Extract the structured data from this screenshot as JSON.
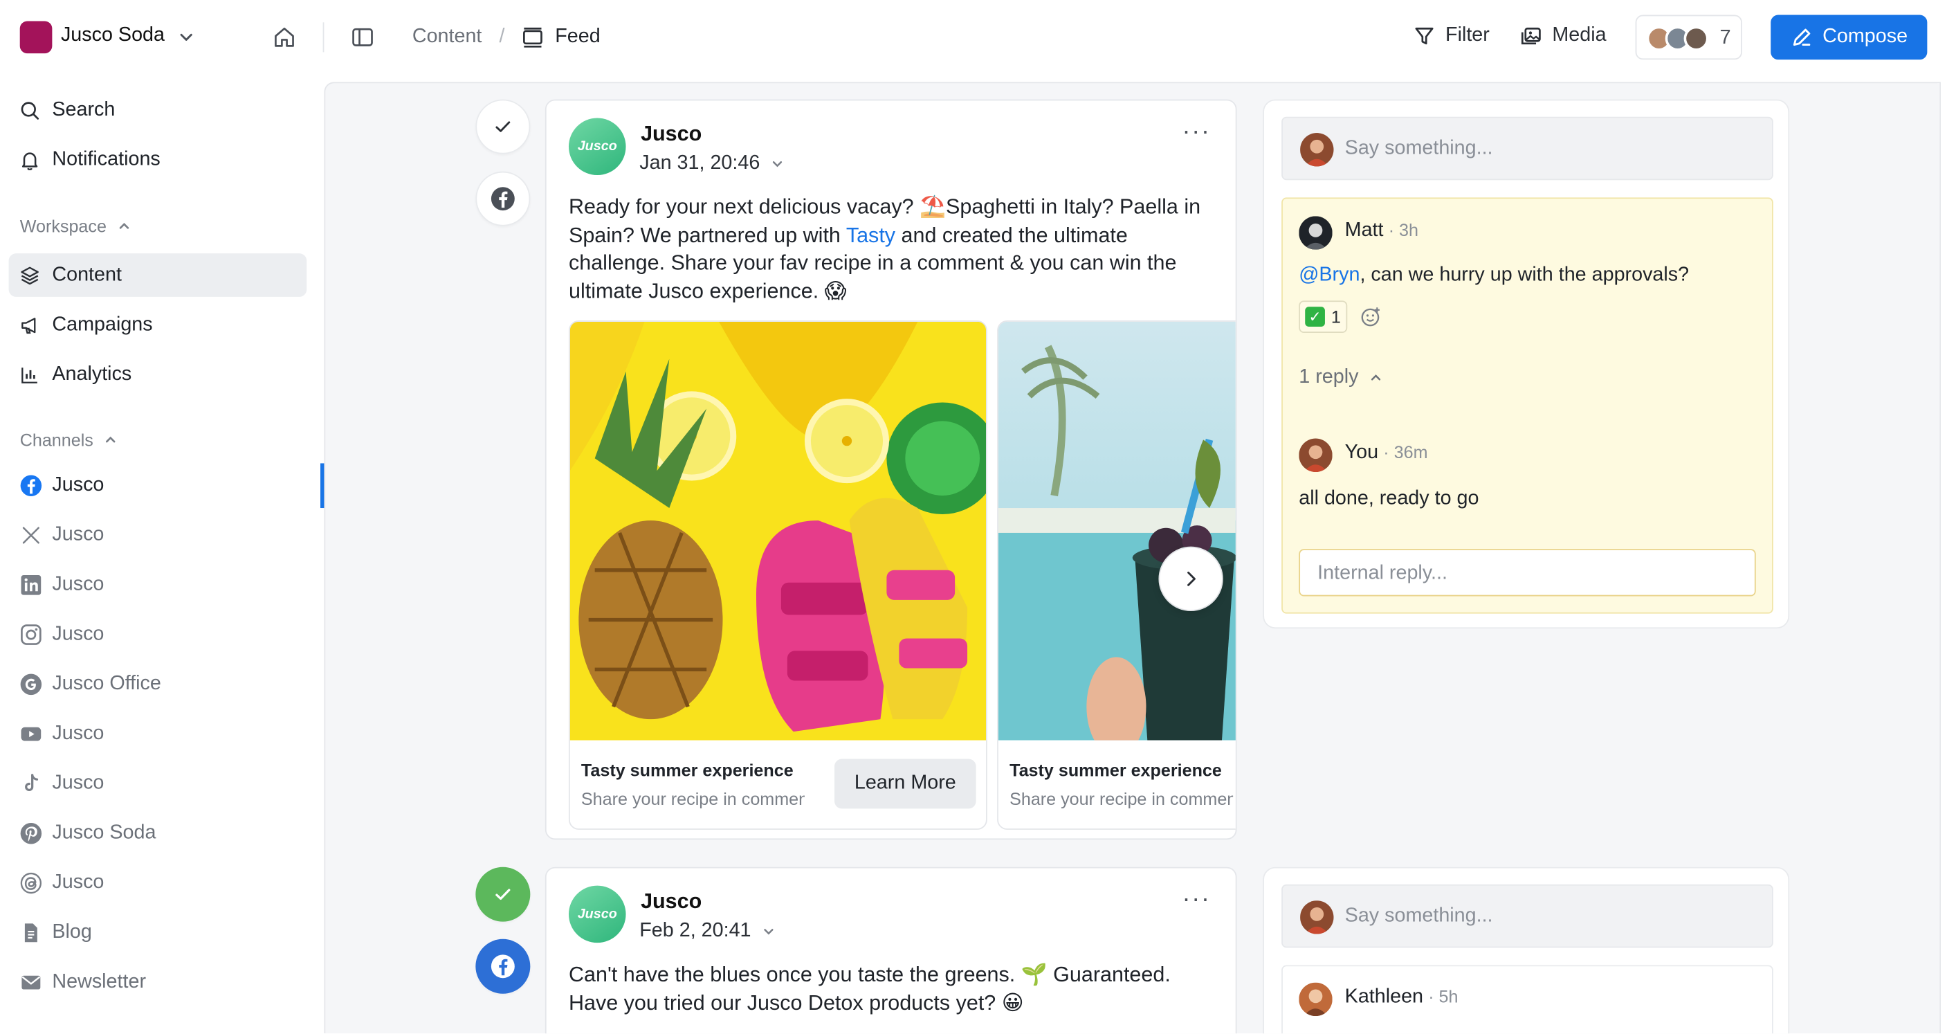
{
  "workspace": {
    "name": "Jusco Soda",
    "color": "#a3135a"
  },
  "breadcrumb": {
    "section": "Content",
    "separator": "/",
    "page": "Feed"
  },
  "toolbar": {
    "filter_label": "Filter",
    "media_label": "Media",
    "team_count": "7",
    "compose_label": "Compose",
    "accent": "#1874e6"
  },
  "sidebar": {
    "search_label": "Search",
    "notifications_label": "Notifications",
    "workspace_section": "Workspace",
    "workspace_items": [
      {
        "label": "Content",
        "icon": "layers-icon",
        "active": true
      },
      {
        "label": "Campaigns",
        "icon": "megaphone-icon"
      },
      {
        "label": "Analytics",
        "icon": "bar-chart-icon"
      }
    ],
    "channels_section": "Channels",
    "channels": [
      {
        "label": "Jusco",
        "icon": "facebook-icon",
        "active": true
      },
      {
        "label": "Jusco",
        "icon": "x-icon"
      },
      {
        "label": "Jusco",
        "icon": "linkedin-icon"
      },
      {
        "label": "Jusco",
        "icon": "instagram-icon"
      },
      {
        "label": "Jusco Office",
        "icon": "google-icon"
      },
      {
        "label": "Jusco",
        "icon": "youtube-icon"
      },
      {
        "label": "Jusco",
        "icon": "tiktok-icon"
      },
      {
        "label": "Jusco Soda",
        "icon": "pinterest-icon"
      },
      {
        "label": "Jusco",
        "icon": "threads-icon"
      },
      {
        "label": "Blog",
        "icon": "document-icon"
      },
      {
        "label": "Newsletter",
        "icon": "mail-icon"
      }
    ]
  },
  "posts": [
    {
      "author": "Jusco",
      "avatar_text": "Jusco",
      "date": "Jan 31, 20:46",
      "more": "···",
      "text_before": "Ready for your next delicious vacay? ⛱️Spaghetti in Italy? Paella in Spain? We partnered up with ",
      "text_link": "Tasty",
      "text_after": " and created the ultimate challenge. Share your fav recipe in a comment & you can win the ultimate Jusco experience. 😱",
      "carousel": [
        {
          "title": "Tasty summer experience",
          "subtitle": "Share your recipe in comment",
          "cta": "Learn More"
        },
        {
          "title": "Tasty summer experience",
          "subtitle": "Share your recipe in comment"
        }
      ],
      "comments": {
        "placeholder": "Say something...",
        "thread": {
          "author": "Matt",
          "time": "· 3h",
          "mention": "@Bryn",
          "text": ", can we hurry up with the approvals?",
          "reaction_emoji": "✓",
          "reaction_count": "1",
          "replies_label": "1 reply",
          "reply": {
            "author": "You",
            "time": "· 36m",
            "text": "all done, ready to go"
          },
          "reply_placeholder": "Internal reply..."
        }
      }
    },
    {
      "author": "Jusco",
      "avatar_text": "Jusco",
      "date": "Feb 2, 20:41",
      "more": "···",
      "text": "Can't have the blues once you taste the greens. 🌱 Guaranteed. Have you tried our Jusco Detox products yet? 😀",
      "comments": {
        "placeholder": "Say something...",
        "first_author": "Kathleen",
        "first_time": "· 5h"
      }
    }
  ]
}
